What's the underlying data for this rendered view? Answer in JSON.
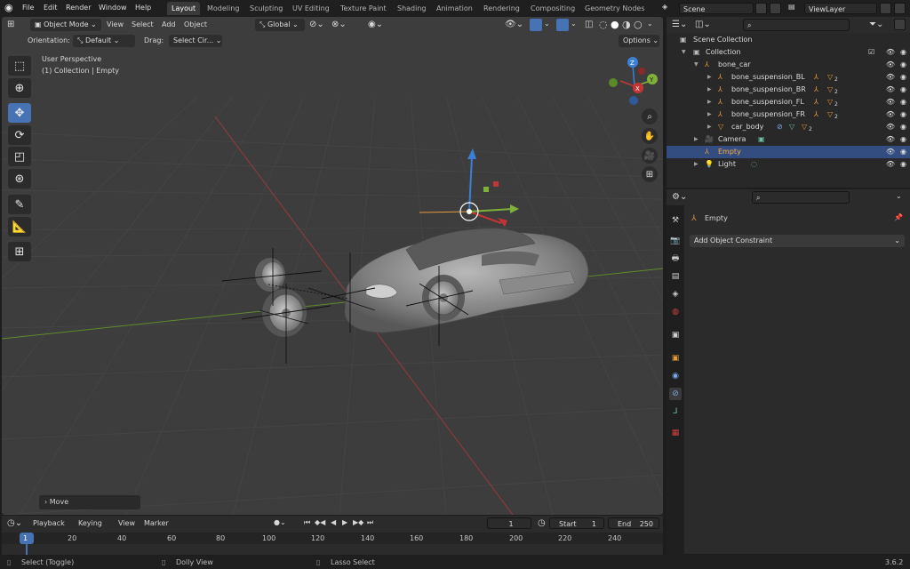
{
  "topbar": {
    "menus": [
      "File",
      "Edit",
      "Render",
      "Window",
      "Help"
    ],
    "workspaces": [
      "Layout",
      "Modeling",
      "Sculpting",
      "UV Editing",
      "Texture Paint",
      "Shading",
      "Animation",
      "Rendering",
      "Compositing",
      "Geometry Nodes"
    ],
    "active_workspace": "Layout",
    "scene": "Scene",
    "view_layer": "ViewLayer"
  },
  "viewport": {
    "mode": "Object Mode",
    "menus": [
      "View",
      "Select",
      "Add",
      "Object"
    ],
    "transform_orientation": "Global",
    "orientation_label": "Orientation:",
    "orientation_value": "Default",
    "drag_label": "Drag:",
    "drag_value": "Select Cir...",
    "options_label": "Options",
    "overlay_title": "User Perspective",
    "overlay_subtitle": "(1) Collection | Empty",
    "gizmo_axes": [
      "X",
      "Y",
      "Z"
    ],
    "last_operator": "Move"
  },
  "outliner": {
    "root": "Scene Collection",
    "rows": [
      {
        "label": "Collection",
        "depth": 1
      },
      {
        "label": "bone_car",
        "depth": 2
      },
      {
        "label": "bone_suspension_BL",
        "depth": 3,
        "badge": "2"
      },
      {
        "label": "bone_suspension_BR",
        "depth": 3,
        "badge": "2"
      },
      {
        "label": "bone_suspension_FL",
        "depth": 3,
        "badge": "2"
      },
      {
        "label": "bone_suspension_FR",
        "depth": 3,
        "badge": "2"
      },
      {
        "label": "car_body",
        "depth": 3,
        "badge": "2"
      },
      {
        "label": "Camera",
        "depth": 2
      },
      {
        "label": "Empty",
        "depth": 2,
        "selected": true
      },
      {
        "label": "Light",
        "depth": 2
      }
    ]
  },
  "properties": {
    "object_name": "Empty",
    "add_constraint": "Add Object Constraint"
  },
  "timeline": {
    "menus": [
      "Playback",
      "Keying",
      "View",
      "Marker"
    ],
    "current_frame": "1",
    "start_label": "Start",
    "start": "1",
    "end_label": "End",
    "end": "250",
    "ruler": [
      "1",
      "20",
      "40",
      "60",
      "80",
      "100",
      "120",
      "140",
      "160",
      "180",
      "200",
      "220",
      "240"
    ]
  },
  "statusbar": {
    "left": "Select (Toggle)",
    "middle": "Dolly View",
    "right": "Lasso Select",
    "version": "3.6.2"
  },
  "colors": {
    "accent": "#4772b3",
    "selected_row": "#334d80",
    "x_axis": "#c53434",
    "y_axis": "#7fb13a",
    "z_axis": "#3c7fd6"
  }
}
